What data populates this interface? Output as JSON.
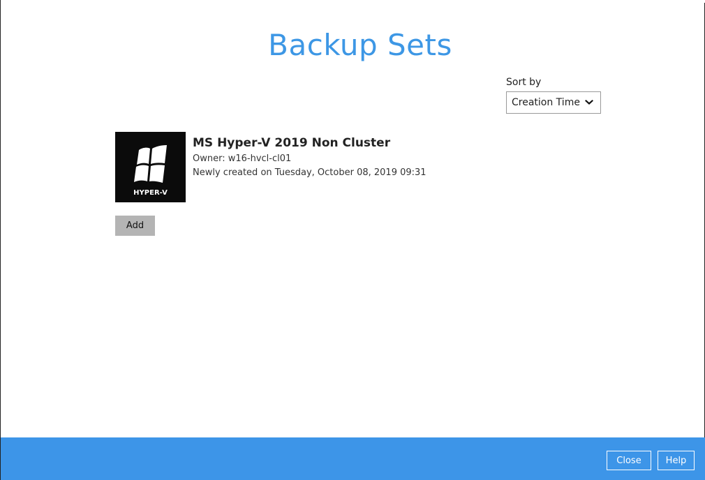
{
  "page": {
    "title": "Backup Sets"
  },
  "sort": {
    "label": "Sort by",
    "selected": "Creation Time"
  },
  "backup_sets": [
    {
      "name": "MS Hyper-V 2019 Non Cluster",
      "owner": "Owner: w16-hvcl-cl01",
      "created": "Newly created on Tuesday, October 08, 2019 09:31",
      "logo_icon": "windows-logo-icon",
      "logo_caption": "HYPER-V"
    }
  ],
  "actions": {
    "add_label": "Add"
  },
  "footer": {
    "close_label": "Close",
    "help_label": "Help"
  },
  "colors": {
    "accent": "#3d97e5",
    "footer_bg": "#3d95e8",
    "add_button_bg": "#b4b4b4",
    "logo_bg": "#0b0b0b"
  }
}
